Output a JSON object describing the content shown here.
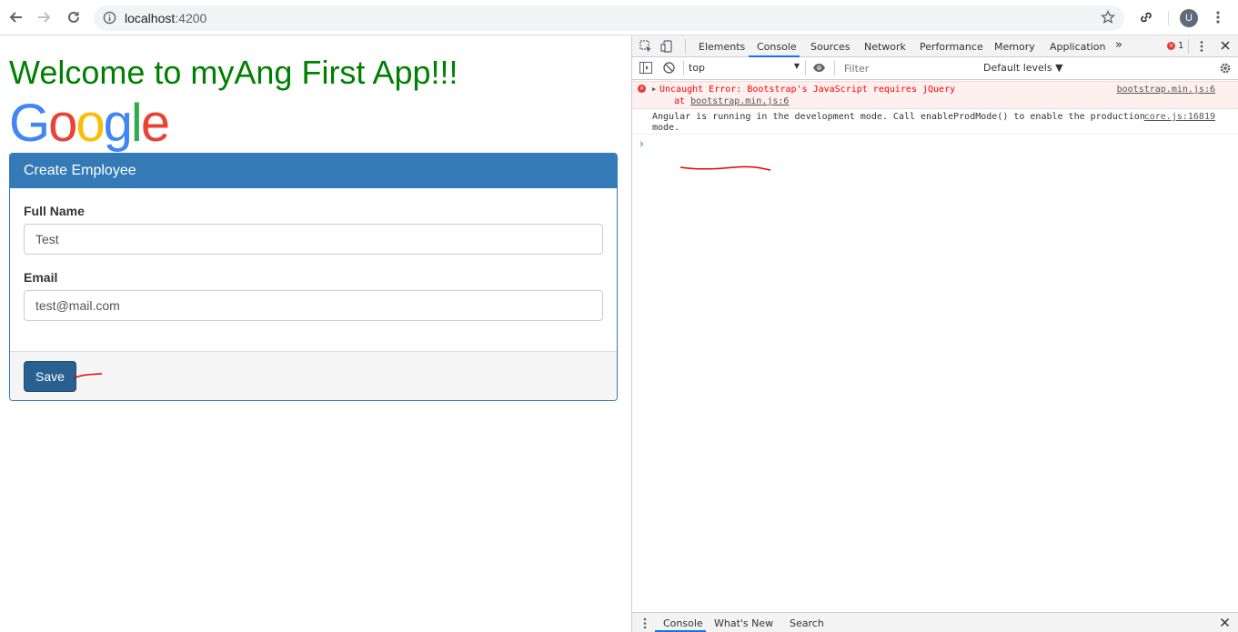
{
  "browser": {
    "url_host": "localhost",
    "url_port": ":4200",
    "avatar_letter": "U"
  },
  "page": {
    "heading": "Welcome to myAng First App!!!",
    "logo_letters": [
      "G",
      "o",
      "o",
      "g",
      "l",
      "e"
    ],
    "panel_title": "Create Employee",
    "full_name_label": "Full Name",
    "full_name_value": "Test",
    "email_label": "Email",
    "email_value": "test@mail.com",
    "save_label": "Save"
  },
  "devtools": {
    "tabs": [
      "Elements",
      "Console",
      "Sources",
      "Network",
      "Performance",
      "Memory",
      "Application"
    ],
    "more_tabs": "»",
    "error_count": "1",
    "context": "top",
    "filter_placeholder": "Filter",
    "levels": "Default levels ▼",
    "messages": {
      "error_text": "Uncaught Error: Bootstrap's JavaScript requires jQuery",
      "error_at_prefix": "at ",
      "error_at_link": "bootstrap.min.js:6",
      "error_source": "bootstrap.min.js:6",
      "info_line1": "Angular is running in the development mode. Call enableProdMode() to enable the production",
      "info_line2": "mode.",
      "info_source": "core.js:16819"
    },
    "prompt": "›",
    "drawer_tabs": [
      "Console",
      "What's New",
      "Search"
    ]
  },
  "colors": {
    "heading_green": "#008000",
    "panel_primary": "#337ab7",
    "save_button": "#286090",
    "error_red": "#ff0000"
  }
}
